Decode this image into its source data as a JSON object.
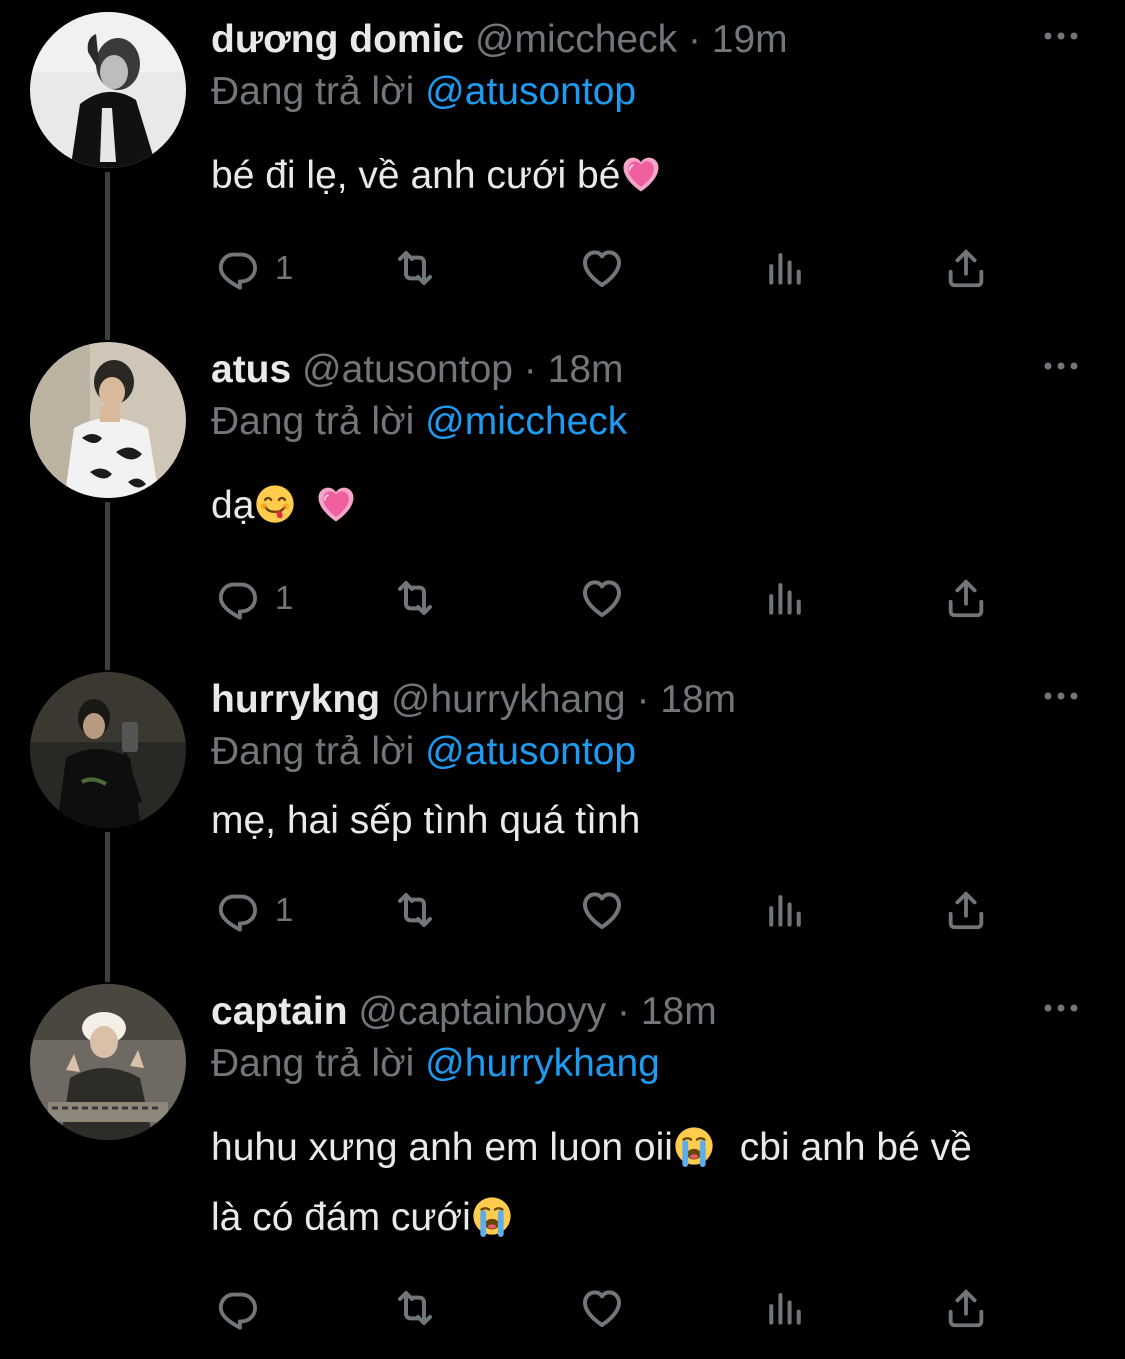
{
  "colors": {
    "background": "#000000",
    "text": "#e7e9ea",
    "secondary": "#71767b",
    "accent": "#1d9bf0",
    "thread_line": "#3b3f44"
  },
  "tweets": [
    {
      "display_name": "dương domic",
      "handle": "@miccheck",
      "time": "19m",
      "reply_prefix": "Đang trả lời",
      "reply_handle": "@atusontop",
      "text": "bé đi lẹ, về anh cưới bé",
      "emoji": [
        "pink-heart"
      ],
      "reply_count": "1"
    },
    {
      "display_name": "atus",
      "handle": "@atusontop",
      "time": "18m",
      "reply_prefix": "Đang trả lời",
      "reply_handle": "@miccheck",
      "text": "dạ",
      "emoji": [
        "savoring-food-face",
        "pink-heart"
      ],
      "reply_count": "1"
    },
    {
      "display_name": "hurrykng",
      "handle": "@hurrykhang",
      "time": "18m",
      "reply_prefix": "Đang trả lời",
      "reply_handle": "@atusontop",
      "text": "mẹ, hai sếp tình quá tình",
      "emoji": [],
      "reply_count": "1"
    },
    {
      "display_name": "captain",
      "handle": "@captainboyy",
      "time": "18m",
      "reply_prefix": "Đang trả lời",
      "reply_handle": "@hurrykhang",
      "text_line1_a": "huhu xưng anh em luon oii",
      "text_line1_b": "cbi anh bé về",
      "text_line2": "là có đám cưới",
      "emoji": [
        "loudly-crying-face",
        "loudly-crying-face"
      ],
      "reply_count": ""
    }
  ],
  "separator": "·",
  "icons": [
    "reply-icon",
    "retweet-icon",
    "like-icon",
    "views-icon",
    "share-icon",
    "more-icon"
  ]
}
